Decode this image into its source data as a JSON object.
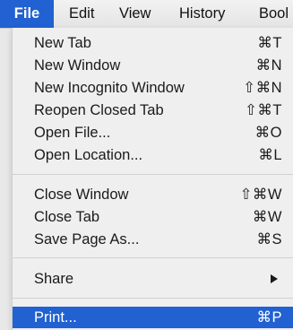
{
  "menubar": {
    "items": [
      "File",
      "Edit",
      "View",
      "History",
      "Bool"
    ]
  },
  "menu": {
    "groups": [
      [
        {
          "label": "New Tab",
          "shortcut": "⌘T"
        },
        {
          "label": "New Window",
          "shortcut": "⌘N"
        },
        {
          "label": "New Incognito Window",
          "shortcut": "⇧⌘N"
        },
        {
          "label": "Reopen Closed Tab",
          "shortcut": "⇧⌘T"
        },
        {
          "label": "Open File...",
          "shortcut": "⌘O"
        },
        {
          "label": "Open Location...",
          "shortcut": "⌘L"
        }
      ],
      [
        {
          "label": "Close Window",
          "shortcut": "⇧⌘W"
        },
        {
          "label": "Close Tab",
          "shortcut": "⌘W"
        },
        {
          "label": "Save Page As...",
          "shortcut": "⌘S"
        }
      ],
      [
        {
          "label": "Share",
          "icon": "submenu-arrow-icon"
        }
      ],
      [
        {
          "label": "Print...",
          "shortcut": "⌘P",
          "highlighted": true
        }
      ]
    ]
  },
  "colors": {
    "accent": "#2161d2",
    "menu_background": "#efefef",
    "menubar_background": "#e8e8e8"
  }
}
